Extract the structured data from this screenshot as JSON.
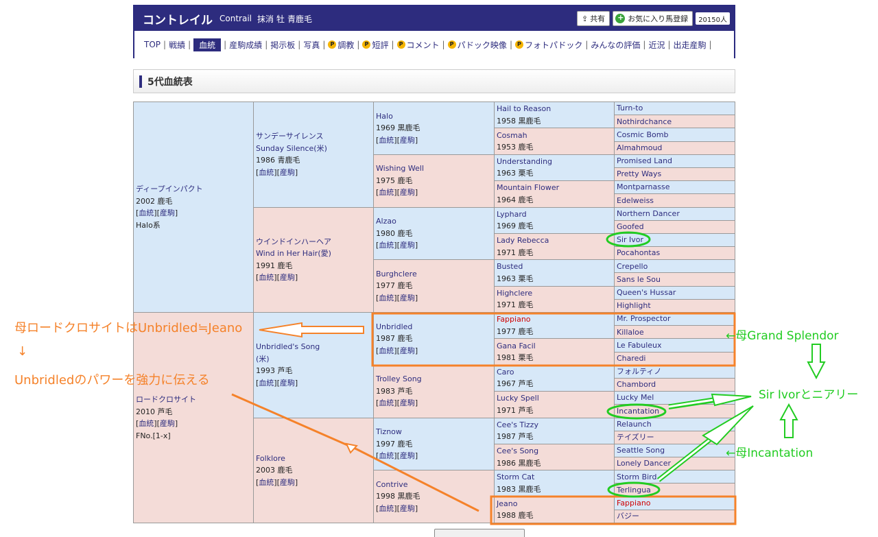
{
  "header": {
    "name": "コントレイル",
    "name_en": "Contrail",
    "status": "抹消",
    "sex": "牡",
    "color": "青鹿毛",
    "share": "共有",
    "favorite": "お気に入り馬登録",
    "fav_count": "20150人"
  },
  "nav": [
    {
      "label": "TOP"
    },
    {
      "label": "戦績"
    },
    {
      "label": "血統",
      "active": true
    },
    {
      "label": "産駒成績"
    },
    {
      "label": "掲示板"
    },
    {
      "label": "写真"
    },
    {
      "label": "調教",
      "p": true
    },
    {
      "label": "短評",
      "p": true
    },
    {
      "label": "コメント",
      "p": true
    },
    {
      "label": "パドック映像",
      "p": true
    },
    {
      "label": "フォトパドック",
      "p": true
    },
    {
      "label": "みんなの評価"
    },
    {
      "label": "近況"
    },
    {
      "label": "出走産駒"
    }
  ],
  "section_title": "5代血統表",
  "pedigree": {
    "g1": [
      {
        "name": "ディープインパクト",
        "year": "2002",
        "color": "鹿毛",
        "note": "Halo系"
      },
      {
        "name": "ロードクロサイト",
        "year": "2010",
        "color": "芦毛",
        "note": "FNo.[1-x]"
      }
    ],
    "g2": [
      {
        "name": "サンデーサイレンス",
        "name2": "Sunday Silence(米)",
        "year": "1986",
        "color": "青鹿毛"
      },
      {
        "name": "ウインドインハーヘア",
        "name2": "Wind in Her Hair(愛)",
        "year": "1991",
        "color": "鹿毛"
      },
      {
        "name": "Unbridled's Song",
        "name2": "(米)",
        "year": "1993",
        "color": "芦毛"
      },
      {
        "name": "Folklore",
        "year": "2003",
        "color": "鹿毛"
      }
    ],
    "g3": [
      {
        "name": "Halo",
        "year": "1969",
        "color": "黒鹿毛"
      },
      {
        "name": "Wishing Well",
        "year": "1975",
        "color": "鹿毛"
      },
      {
        "name": "Alzao",
        "year": "1980",
        "color": "鹿毛"
      },
      {
        "name": "Burghclere",
        "year": "1977",
        "color": "鹿毛"
      },
      {
        "name": "Unbridled",
        "year": "1987",
        "color": "鹿毛"
      },
      {
        "name": "Trolley Song",
        "year": "1983",
        "color": "芦毛"
      },
      {
        "name": "Tiznow",
        "year": "1997",
        "color": "鹿毛"
      },
      {
        "name": "Contrive",
        "year": "1998",
        "color": "黒鹿毛"
      }
    ],
    "g4": [
      {
        "name": "Hail to Reason",
        "yc": "1958 黒鹿毛"
      },
      {
        "name": "Cosmah",
        "yc": "1953 鹿毛"
      },
      {
        "name": "Understanding",
        "yc": "1963 栗毛"
      },
      {
        "name": "Mountain Flower",
        "yc": "1964 鹿毛"
      },
      {
        "name": "Lyphard",
        "yc": "1969 鹿毛"
      },
      {
        "name": "Lady Rebecca",
        "yc": "1971 鹿毛"
      },
      {
        "name": "Busted",
        "yc": "1963 栗毛"
      },
      {
        "name": "Highclere",
        "yc": "1971 鹿毛"
      },
      {
        "name": "Fappiano",
        "yc": "1977 鹿毛",
        "red": true
      },
      {
        "name": "Gana Facil",
        "yc": "1981 栗毛"
      },
      {
        "name": "Caro",
        "yc": "1967 芦毛"
      },
      {
        "name": "Lucky Spell",
        "yc": "1971 芦毛"
      },
      {
        "name": "Cee's Tizzy",
        "yc": "1987 芦毛"
      },
      {
        "name": "Cee's Song",
        "yc": "1986 黒鹿毛"
      },
      {
        "name": "Storm Cat",
        "yc": "1983 黒鹿毛"
      },
      {
        "name": "Jeano",
        "yc": "1988 鹿毛"
      }
    ],
    "g5": [
      {
        "name": "Turn-to"
      },
      {
        "name": "Nothirdchance"
      },
      {
        "name": "Cosmic Bomb"
      },
      {
        "name": "Almahmoud"
      },
      {
        "name": "Promised Land"
      },
      {
        "name": "Pretty Ways"
      },
      {
        "name": "Montparnasse"
      },
      {
        "name": "Edelweiss"
      },
      {
        "name": "Northern Dancer"
      },
      {
        "name": "Goofed"
      },
      {
        "name": "Sir Ivor"
      },
      {
        "name": "Pocahontas"
      },
      {
        "name": "Crepello"
      },
      {
        "name": "Sans le Sou"
      },
      {
        "name": "Queen's Hussar"
      },
      {
        "name": "Highlight"
      },
      {
        "name": "Mr. Prospector"
      },
      {
        "name": "Killaloe"
      },
      {
        "name": "Le Fabuleux"
      },
      {
        "name": "Charedi"
      },
      {
        "name": "フォルティノ"
      },
      {
        "name": "Chambord"
      },
      {
        "name": "Lucky Mel"
      },
      {
        "name": "Incantation"
      },
      {
        "name": "Relaunch"
      },
      {
        "name": "テイズリー"
      },
      {
        "name": "Seattle Song"
      },
      {
        "name": "Lonely Dancer"
      },
      {
        "name": "Storm Bird"
      },
      {
        "name": "Terlingua"
      },
      {
        "name": "Fappiano",
        "red": true
      },
      {
        "name": "バジー"
      }
    ],
    "link_blood": "血統",
    "link_offspring": "産駒"
  },
  "annotations": {
    "left1": "母ロードクロサイトはUnbridled≒Jeano",
    "arrow_down": "↓",
    "left2": "Unbridledのパワーを強力に伝える",
    "grand_splendor": "←母Grand Splendor",
    "sir_ivor": "Sir Ivorとニアリー",
    "incantation": "←母Incantation",
    "orange": "#f5822a",
    "green": "#22cc22"
  }
}
